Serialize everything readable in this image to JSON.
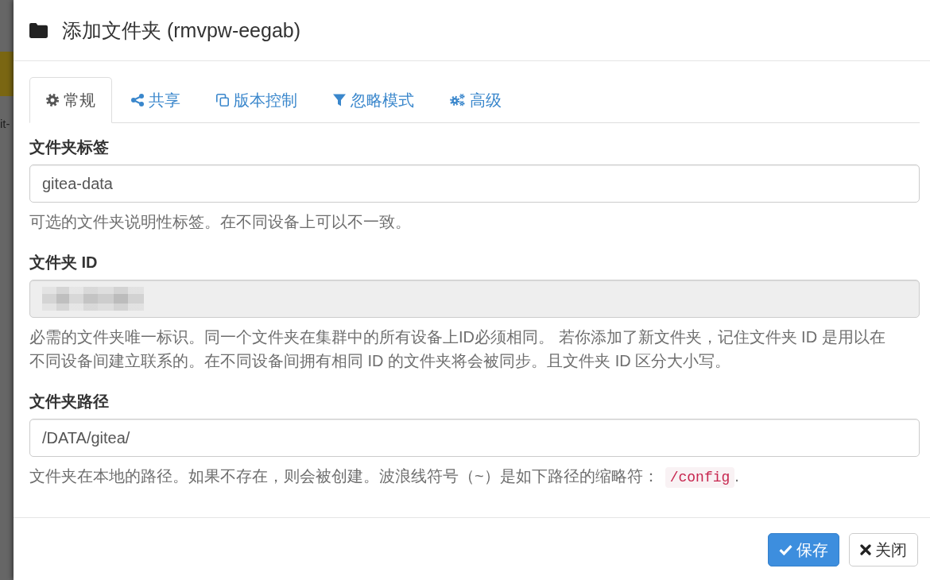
{
  "backdrop": {
    "text": "it-"
  },
  "dialog": {
    "title": "添加文件夹 (rmvpw-eegab)"
  },
  "tabs": [
    {
      "label": "常规",
      "selected": true
    },
    {
      "label": "共享",
      "selected": false
    },
    {
      "label": "版本控制",
      "selected": false
    },
    {
      "label": "忽略模式",
      "selected": false
    },
    {
      "label": "高级",
      "selected": false
    }
  ],
  "fields": [
    {
      "label": "文件夹标签",
      "kind": "text",
      "value": "gitea-data",
      "disabled": false,
      "help": [
        {
          "kind": "text",
          "text": "可选的文件夹说明性标签。在不同设备上可以不一致。"
        }
      ]
    },
    {
      "label": "文件夹 ID",
      "kind": "redacted",
      "disabled": true,
      "help": [
        {
          "kind": "text",
          "text": "必需的文件夹唯一标识。同一个文件夹在集群中的所有设备上ID必须相同。 若你添加了新文件夹，记住文件夹 ID 是用以在不同设备间建立联系的。在不同设备间拥有相同 ID 的文件夹将会被同步。且文件夹 ID 区分大小写。"
        }
      ]
    },
    {
      "label": "文件夹路径",
      "kind": "text",
      "value": "/DATA/gitea/",
      "disabled": false,
      "help": [
        {
          "kind": "text",
          "text": "文件夹在本地的路径。如果不存在，则会被创建。波浪线符号（~）是如下路径的缩略符："
        },
        {
          "kind": "code",
          "text": "/config"
        },
        {
          "kind": "text",
          "text": "."
        }
      ]
    }
  ],
  "buttons": [
    {
      "label": "保存",
      "kind": "primary"
    },
    {
      "label": "关闭",
      "kind": "default"
    }
  ]
}
